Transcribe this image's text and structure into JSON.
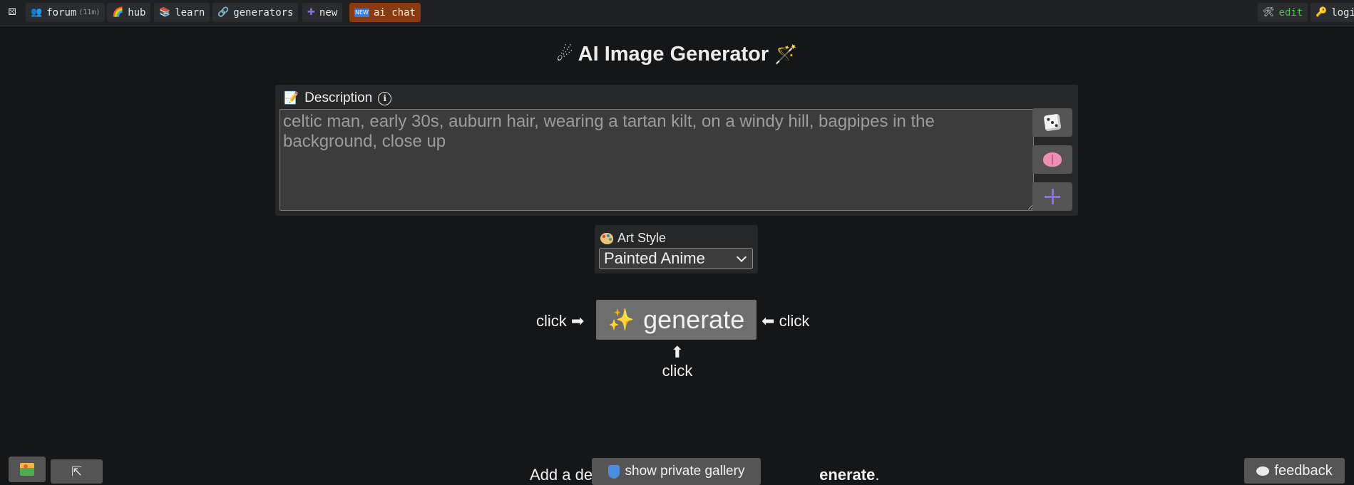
{
  "topbar": {
    "home_icon": "dice-icon",
    "items": [
      {
        "label": "forum",
        "extra": "(11m)",
        "icon": "people-icon"
      },
      {
        "label": "hub",
        "icon": "rainbow-icon"
      },
      {
        "label": "learn",
        "icon": "books-icon"
      },
      {
        "label": "generators",
        "icon": "link-icon"
      },
      {
        "label": "new",
        "icon": "plus-icon"
      },
      {
        "label": "ai chat",
        "icon": "new-badge-icon"
      }
    ],
    "right_items": [
      {
        "label": "edit",
        "icon": "tools-icon"
      },
      {
        "label": "logi",
        "icon": "key-icon"
      }
    ],
    "colors": {
      "ai_chat_bg": "#8a3a10",
      "edit_text": "#49c04f"
    }
  },
  "title": {
    "text": "AI Image Generator",
    "left_icon": "comet-icon",
    "right_icon": "magic-wand-icon"
  },
  "description": {
    "label": "Description",
    "placeholder": "celtic man, early 30s, auburn hair, wearing a tartan kilt, on a windy hill, bagpipes in the background, close up",
    "buttons": [
      "dice-icon",
      "brain-icon",
      "plus-icon"
    ]
  },
  "art_style": {
    "label": "Art Style",
    "selected": "Painted Anime"
  },
  "generate": {
    "label": "generate",
    "hint_left": "click",
    "hint_right": "click",
    "hint_below": "click"
  },
  "bottom": {
    "text_start": "Add a de",
    "text_end_bold": "enerate",
    "text_end": ".",
    "private_gallery": "show private gallery",
    "feedback": "feedback"
  }
}
